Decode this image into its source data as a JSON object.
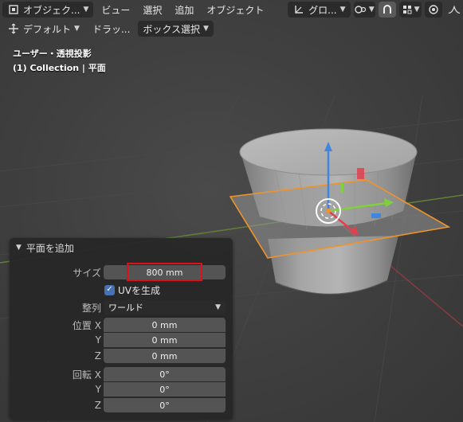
{
  "header": {
    "mode_label": "オブジェク...",
    "menus": [
      "ビュー",
      "選択",
      "追加",
      "オブジェクト"
    ],
    "transform_orientation_label": "グロ..."
  },
  "subheader": {
    "pivot_label": "デフォルト",
    "drag_label": "ドラッ...",
    "select_mode_label": "ボックス選択"
  },
  "viewport": {
    "view_label": "ユーザー・透視投影",
    "collection_label": "(1) Collection | 平面"
  },
  "operator_panel": {
    "title": "平面を追加",
    "size_label": "サイズ",
    "size_value": "800 mm",
    "uv_label": "UVを生成",
    "uv_checked": true,
    "align_label": "整列",
    "align_value": "ワールド",
    "location_label": "位置",
    "location": [
      {
        "axis": "X",
        "value": "0 mm"
      },
      {
        "axis": "Y",
        "value": "0 mm"
      },
      {
        "axis": "Z",
        "value": "0 mm"
      }
    ],
    "rotation_label": "回転",
    "rotation": [
      {
        "axis": "X",
        "value": "0°"
      },
      {
        "axis": "Y",
        "value": "0°"
      },
      {
        "axis": "Z",
        "value": "0°"
      }
    ]
  },
  "colors": {
    "selection_outline": "#f0932a",
    "highlight_box": "#e0101a",
    "axis_x": "#e2404e",
    "axis_y": "#7fd03a",
    "axis_z": "#3f86e0",
    "checkbox": "#4772b3"
  }
}
